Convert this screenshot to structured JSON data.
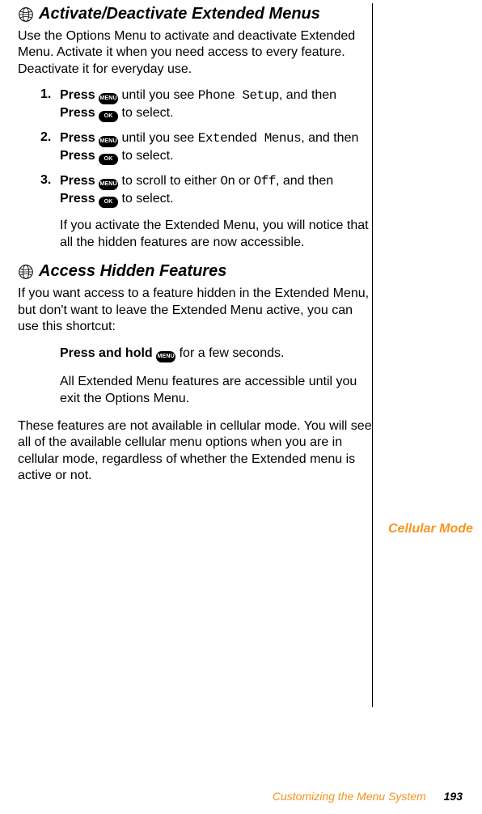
{
  "sections": {
    "s1": {
      "title": "Activate/Deactivate Extended Menus",
      "intro": "Use the Options Menu to activate and deactivate Extended Menu. Activate it when you need access to every feature. Deactivate it for everyday use."
    },
    "s2": {
      "title": "Access Hidden Features",
      "intro": "If you want access to a feature hidden in the Extended Menu, but don't want to leave the Extended Menu active, you can use this shortcut:"
    }
  },
  "steps": {
    "n1": "1.",
    "n2": "2.",
    "n3": "3.",
    "press": "Press",
    "press_hold": "Press and hold",
    "until_you_see": " until you see ",
    "scroll_to": " to scroll to either ",
    "and_then": ", and then ",
    "just_and": ", and then ",
    "to_select": " to select.",
    "phone_setup": "Phone Setup",
    "extended_menus": "Extended Menus",
    "on": "On",
    "or": " or ",
    "off": "Off",
    "few_seconds": " for a few seconds.",
    "result1": "If you activate the Extended Menu, you will notice that all the hidden features are now accessible.",
    "result2": "All Extended Menu features are accessible until you exit the Options Menu."
  },
  "cellular_para": "These features are not available in cellular mode. You will see all of the available cellular menu options when you are in cellular mode, regardless of whether the Extended menu is active or not.",
  "side_note": "Cellular Mode",
  "keys": {
    "menu": "MENU",
    "ok": "OK"
  },
  "footer": {
    "section": "Customizing the Menu System",
    "page": "193"
  }
}
